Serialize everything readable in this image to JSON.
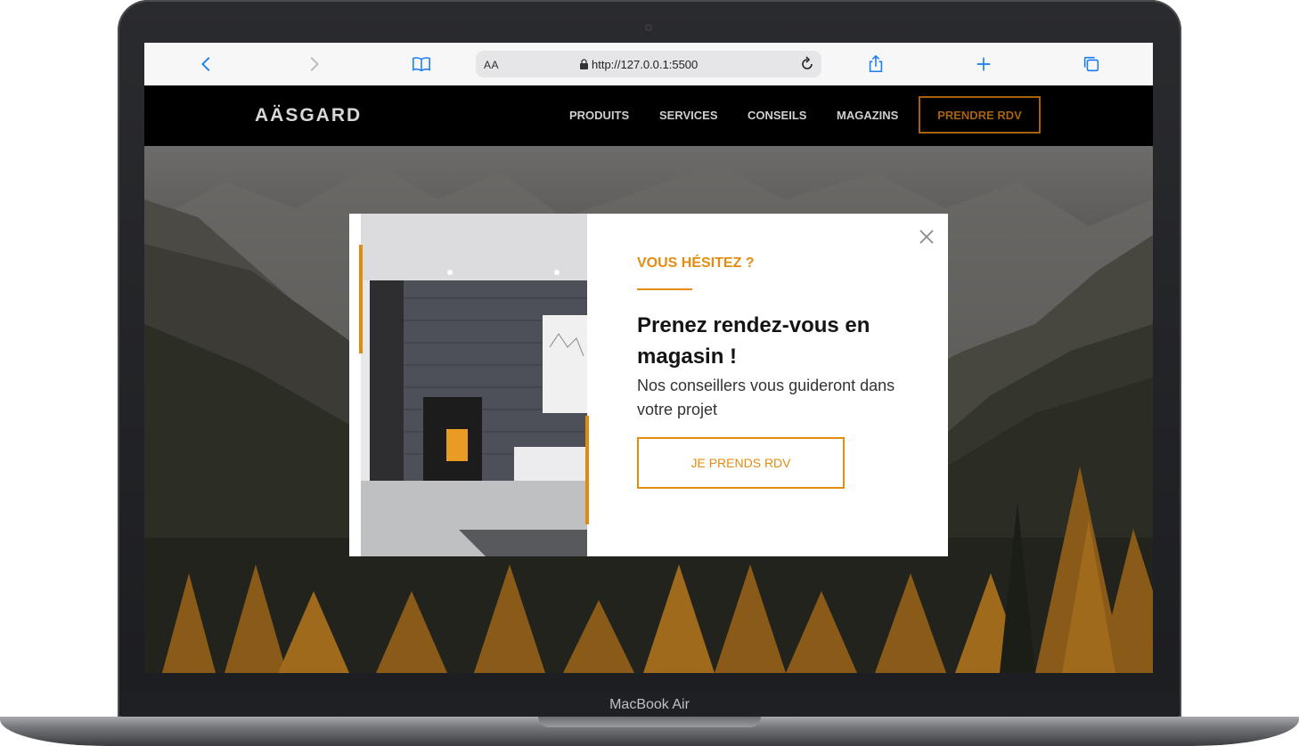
{
  "device": {
    "label": "MacBook Air"
  },
  "browser": {
    "reader_label": "AA",
    "url": "http://127.0.0.1:5500",
    "icons": [
      "back-icon",
      "forward-icon",
      "bookmarks-icon",
      "lock-icon",
      "reload-icon",
      "share-icon",
      "new-tab-icon",
      "tabs-icon"
    ]
  },
  "site": {
    "logo": "AÄSGARD",
    "nav": [
      {
        "label": "PRODUITS"
      },
      {
        "label": "SERVICES"
      },
      {
        "label": "CONSEILS"
      },
      {
        "label": "MAGAZINS"
      }
    ],
    "cta": "PRENDRE RDV",
    "accent_color": "#e38c10"
  },
  "modal": {
    "eyebrow": "VOUS HÉSITEZ ?",
    "headline": "Prenez rendez-vous en magasin !",
    "subtext": "Nos conseillers vous guideront dans votre projet",
    "button": "JE PRENDS RDV",
    "close_icon": "close-icon"
  }
}
